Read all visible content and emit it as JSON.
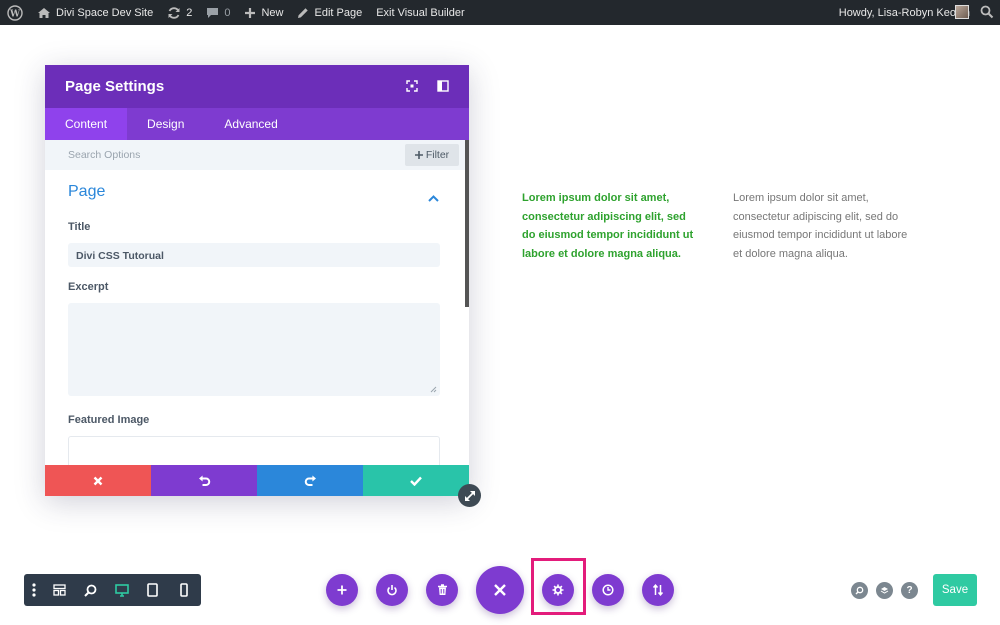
{
  "admin_bar": {
    "site_name": "Divi Space Dev Site",
    "updates_count": "2",
    "comments_count": "0",
    "new_label": "New",
    "edit_page_label": "Edit Page",
    "exit_builder_label": "Exit Visual Builder",
    "howdy_text": "Howdy, Lisa-Robyn Keown"
  },
  "content": {
    "green_text": "Lorem ipsum dolor sit amet, consectetur adipiscing elit, sed do eiusmod tempor incididunt ut labore et dolore magna aliqua.",
    "gray_text": "Lorem ipsum dolor sit amet, consectetur adipiscing elit, sed do eiusmod tempor incididunt ut labore et dolore magna aliqua."
  },
  "modal": {
    "title": "Page Settings",
    "tabs": [
      {
        "label": "Content",
        "active": true
      },
      {
        "label": "Design",
        "active": false
      },
      {
        "label": "Advanced",
        "active": false
      }
    ],
    "search_placeholder": "Search Options",
    "filter_label": "Filter",
    "section_title": "Page",
    "title_label": "Title",
    "title_value": "Divi CSS Tutorual",
    "excerpt_label": "Excerpt",
    "excerpt_value": "",
    "featured_image_label": "Featured Image",
    "footer_buttons": [
      {
        "icon": "close-icon",
        "color": "#ef5555"
      },
      {
        "icon": "undo-icon",
        "color": "#7e3bd0"
      },
      {
        "icon": "redo-icon",
        "color": "#2b87da"
      },
      {
        "icon": "check-icon",
        "color": "#29c4a9"
      }
    ]
  },
  "bottom_bar": {
    "save_label": "Save",
    "left_tools": [
      "more-icon",
      "wireframe-icon",
      "zoom-icon",
      "desktop-icon",
      "tablet-icon",
      "phone-icon"
    ],
    "active_view": "desktop",
    "center_buttons": [
      "add-icon",
      "power-icon",
      "trash-icon",
      "close-icon",
      "gear-icon",
      "history-icon",
      "portability-icon"
    ],
    "highlighted_button": "gear-icon",
    "right_tools": [
      "search-icon",
      "layers-icon",
      "help-icon"
    ]
  },
  "colors": {
    "purple": "#7e3bd0",
    "purple_dark": "#6c2eb9",
    "blue": "#2b87da",
    "red": "#ef5555",
    "teal": "#29c4a9",
    "save_green": "#2fcaa2",
    "highlight_pink": "#e31c7b",
    "admin_bar": "#23282d"
  }
}
